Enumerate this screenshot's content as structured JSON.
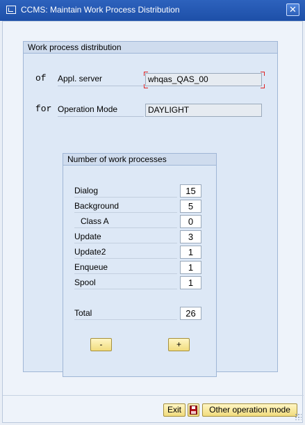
{
  "window": {
    "title": "CCMS: Maintain Work Process Distribution",
    "close_label": "✕"
  },
  "group": {
    "title": "Work process distribution",
    "of_label": "of",
    "appl_server_label": "Appl. server",
    "appl_server_value": "whqas_QAS_00",
    "for_label": "for",
    "operation_mode_label": "Operation Mode",
    "operation_mode_value": "DAYLIGHT"
  },
  "processes": {
    "title": "Number of work processes",
    "rows": [
      {
        "label": "Dialog",
        "value": "15"
      },
      {
        "label": "Background",
        "value": "5"
      },
      {
        "label": "Class A",
        "value": "0"
      },
      {
        "label": "Update",
        "value": "3"
      },
      {
        "label": "Update2",
        "value": "1"
      },
      {
        "label": "Enqueue",
        "value": "1"
      },
      {
        "label": "Spool",
        "value": "1"
      }
    ],
    "total_label": "Total",
    "total_value": "26",
    "minus_label": "-",
    "plus_label": "+"
  },
  "footer": {
    "exit_label": "Exit",
    "save_icon": "save-icon",
    "other_mode_label": "Other operation mode"
  }
}
